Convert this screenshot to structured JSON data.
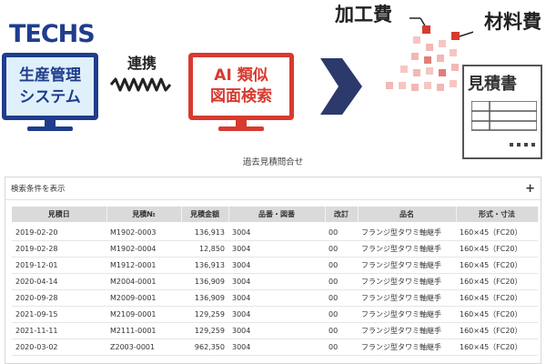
{
  "logo": "TECHS",
  "monitor_left": {
    "line1": "生産管理",
    "line2": "システム"
  },
  "link_label": "連携",
  "monitor_right": {
    "line1": "AI 類似",
    "line2": "図面検索"
  },
  "labels": {
    "kakou": "加工費",
    "zairyou": "材料費"
  },
  "document": {
    "title": "見積書"
  },
  "caption": "過去見積問合せ",
  "panel": {
    "toggle_label": "検索条件を表示",
    "expand_symbol": "+"
  },
  "table": {
    "headers": [
      "見積日",
      "見積№",
      "見積金額",
      "品番・図番",
      "改訂",
      "品名",
      "形式・寸法"
    ],
    "rows": [
      [
        "2019-02-20",
        "M1902-0003",
        "136,913",
        "3004",
        "00",
        "フランジ型タワミ軸継手",
        "160×45（FC20）"
      ],
      [
        "2019-02-28",
        "M1902-0004",
        "12,850",
        "3004",
        "00",
        "フランジ型タワミ軸継手",
        "160×45（FC20）"
      ],
      [
        "2019-12-01",
        "M1912-0001",
        "136,913",
        "3004",
        "00",
        "フランジ型タワミ軸継手",
        "160×45（FC20）"
      ],
      [
        "2020-04-14",
        "M2004-0001",
        "136,909",
        "3004",
        "00",
        "フランジ型タワミ軸継手",
        "160×45（FC20）"
      ],
      [
        "2020-09-28",
        "M2009-0001",
        "136,909",
        "3004",
        "00",
        "フランジ型タワミ軸継手",
        "160×45（FC20）"
      ],
      [
        "2021-09-15",
        "M2109-0001",
        "129,259",
        "3004",
        "00",
        "フランジ型タワミ軸継手",
        "160×45（FC20）"
      ],
      [
        "2021-11-11",
        "M2111-0001",
        "129,259",
        "3004",
        "00",
        "フランジ型タワミ軸継手",
        "160×45（FC20）"
      ],
      [
        "2020-03-02",
        "Z2003-0001",
        "962,350",
        "3004",
        "00",
        "フランジ型タワミ軸継手",
        "160×45（FC20）"
      ]
    ]
  },
  "colors": {
    "brand_blue": "#1f3d8c",
    "accent_red": "#d83a2f",
    "arrow_navy": "#2b3a6b",
    "pixel_pink": "#f2b8b5"
  }
}
